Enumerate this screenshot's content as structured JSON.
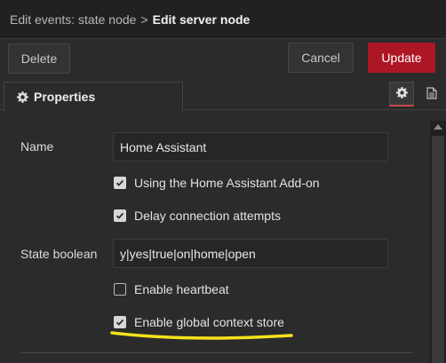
{
  "header": {
    "parent": "Edit events: state node",
    "separator": ">",
    "current": "Edit server node"
  },
  "actions": {
    "delete_label": "Delete",
    "cancel_label": "Cancel",
    "update_label": "Update"
  },
  "tabs": {
    "properties_label": "Properties",
    "icons": [
      "gear-icon",
      "document-icon"
    ]
  },
  "form": {
    "name_label": "Name",
    "name_value": "Home Assistant",
    "addon_label": "Using the Home Assistant Add-on",
    "addon_checked": true,
    "delay_label": "Delay connection attempts",
    "delay_checked": true,
    "state_boolean_label": "State boolean",
    "state_boolean_value": "y|yes|true|on|home|open",
    "heartbeat_label": "Enable heartbeat",
    "heartbeat_checked": false,
    "global_context_label": "Enable global context store",
    "global_context_checked": true
  },
  "colors": {
    "accent": "#ad1625",
    "highlight": "#f5e21b",
    "background": "#2b2b2b"
  }
}
